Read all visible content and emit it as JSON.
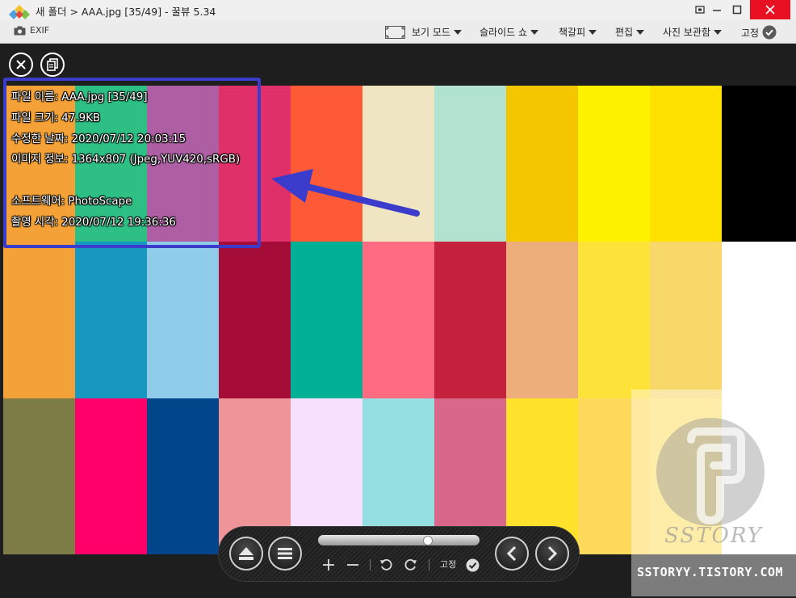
{
  "window": {
    "title": "새 폴더 > AAA.jpg [35/49] - 꿀뷰 5.34"
  },
  "menubar": {
    "exif_label": "EXIF",
    "view_mode": "보기 모드",
    "slideshow": "슬라이드 쇼",
    "bookmark": "책갈피",
    "edit": "편집",
    "save_photo": "사진 보관함",
    "pin": "고정"
  },
  "info": {
    "lines": [
      "파일 이름: AAA.jpg [35/49]",
      "파일 크기: 47.9KB",
      "수정한 날짜: 2020/07/12 20:03:15",
      "이미지 정보: 1364x807 (Jpeg,YUV420,sRGB)",
      "",
      "소프트웨어: PhotoScape",
      "촬영 시각: 2020/07/12 19:36:36"
    ]
  },
  "controls": {
    "pin_label": "고정",
    "slider_position": 0.68
  },
  "watermark": {
    "logo_text": "SSTORY",
    "site": "SSTORYY.TISTORY.COM"
  },
  "colors": {
    "accent_box": "#3b3ccb",
    "close_button": "#e81123",
    "grid": [
      [
        "#f4a137",
        "#2ebf85",
        "#ae5fa3",
        "#e0306a",
        "#ff5a38",
        "#efe5c2",
        "#b2e3d1",
        "#f4c600",
        "#fff200",
        "#ffe100",
        "#000000"
      ],
      [
        "#f2a238",
        "#1898c0",
        "#8ecce9",
        "#a50d38",
        "#00b095",
        "#ff6b81",
        "#c5223d",
        "#eeae7c",
        "#fde23a",
        "#f9d86a",
        "#ffffff"
      ],
      [
        "#7d7c47",
        "#ff006b",
        "#004489",
        "#ef9599",
        "#f6e0fd",
        "#95dfe3",
        "#d8678b",
        "#fee22c",
        "#fed95c",
        "#fde06b",
        "#ffffff"
      ]
    ]
  }
}
